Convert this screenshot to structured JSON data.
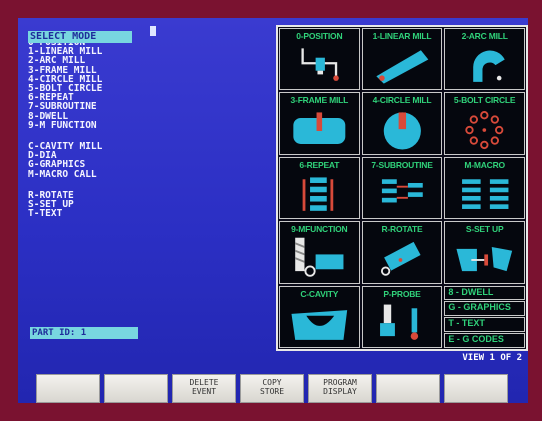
{
  "menu": {
    "title": "SELECT MODE",
    "items_a": [
      "0-POSITION",
      "1-LINEAR MILL",
      "2-ARC MILL",
      "3-FRAME MILL",
      "4-CIRCLE MILL",
      "5-BOLT CIRCLE",
      "6-REPEAT",
      "7-SUBROUTINE",
      "8-DWELL",
      "9-M FUNCTION"
    ],
    "items_b": [
      "C-CAVITY MILL",
      "D-DIA",
      "G-GRAPHICS",
      "M-MACRO CALL"
    ],
    "items_c": [
      "R-ROTATE",
      "S-SET UP",
      "T-TEXT"
    ],
    "part_id": "PART ID: 1"
  },
  "tiles": [
    {
      "label": "0-POSITION",
      "icon": "position-icon"
    },
    {
      "label": "1-LINEAR MILL",
      "icon": "linear-mill-icon"
    },
    {
      "label": "2-ARC MILL",
      "icon": "arc-mill-icon"
    },
    {
      "label": "3-FRAME MILL",
      "icon": "frame-mill-icon"
    },
    {
      "label": "4-CIRCLE MILL",
      "icon": "circle-mill-icon"
    },
    {
      "label": "5-BOLT CIRCLE",
      "icon": "bolt-circle-icon"
    },
    {
      "label": "6-REPEAT",
      "icon": "repeat-icon"
    },
    {
      "label": "7-SUBROUTINE",
      "icon": "subroutine-icon"
    },
    {
      "label": "M-MACRO",
      "icon": "macro-icon"
    },
    {
      "label": "9-MFUNCTION",
      "icon": "m-function-icon"
    },
    {
      "label": "R-ROTATE",
      "icon": "rotate-icon"
    },
    {
      "label": "S-SET UP",
      "icon": "setup-icon"
    },
    {
      "label": "C-CAVITY",
      "icon": "cavity-icon"
    },
    {
      "label": "P-PROBE",
      "icon": "probe-icon"
    }
  ],
  "side_list": [
    "8 - DWELL",
    "G - GRAPHICS",
    "T - TEXT",
    "E - G CODES"
  ],
  "view": "VIEW 1 OF 2",
  "softkeys": [
    "",
    "",
    "DELETE\nEVENT",
    "COPY\nSTORE",
    "PROGRAM\nDISPLAY",
    "",
    ""
  ],
  "colors": {
    "screen": "#2b2fc4",
    "highlight": "#78d6e0",
    "icon_fill": "#2ab8d8",
    "label_green": "#30d27a",
    "frame": "#7a1230"
  }
}
